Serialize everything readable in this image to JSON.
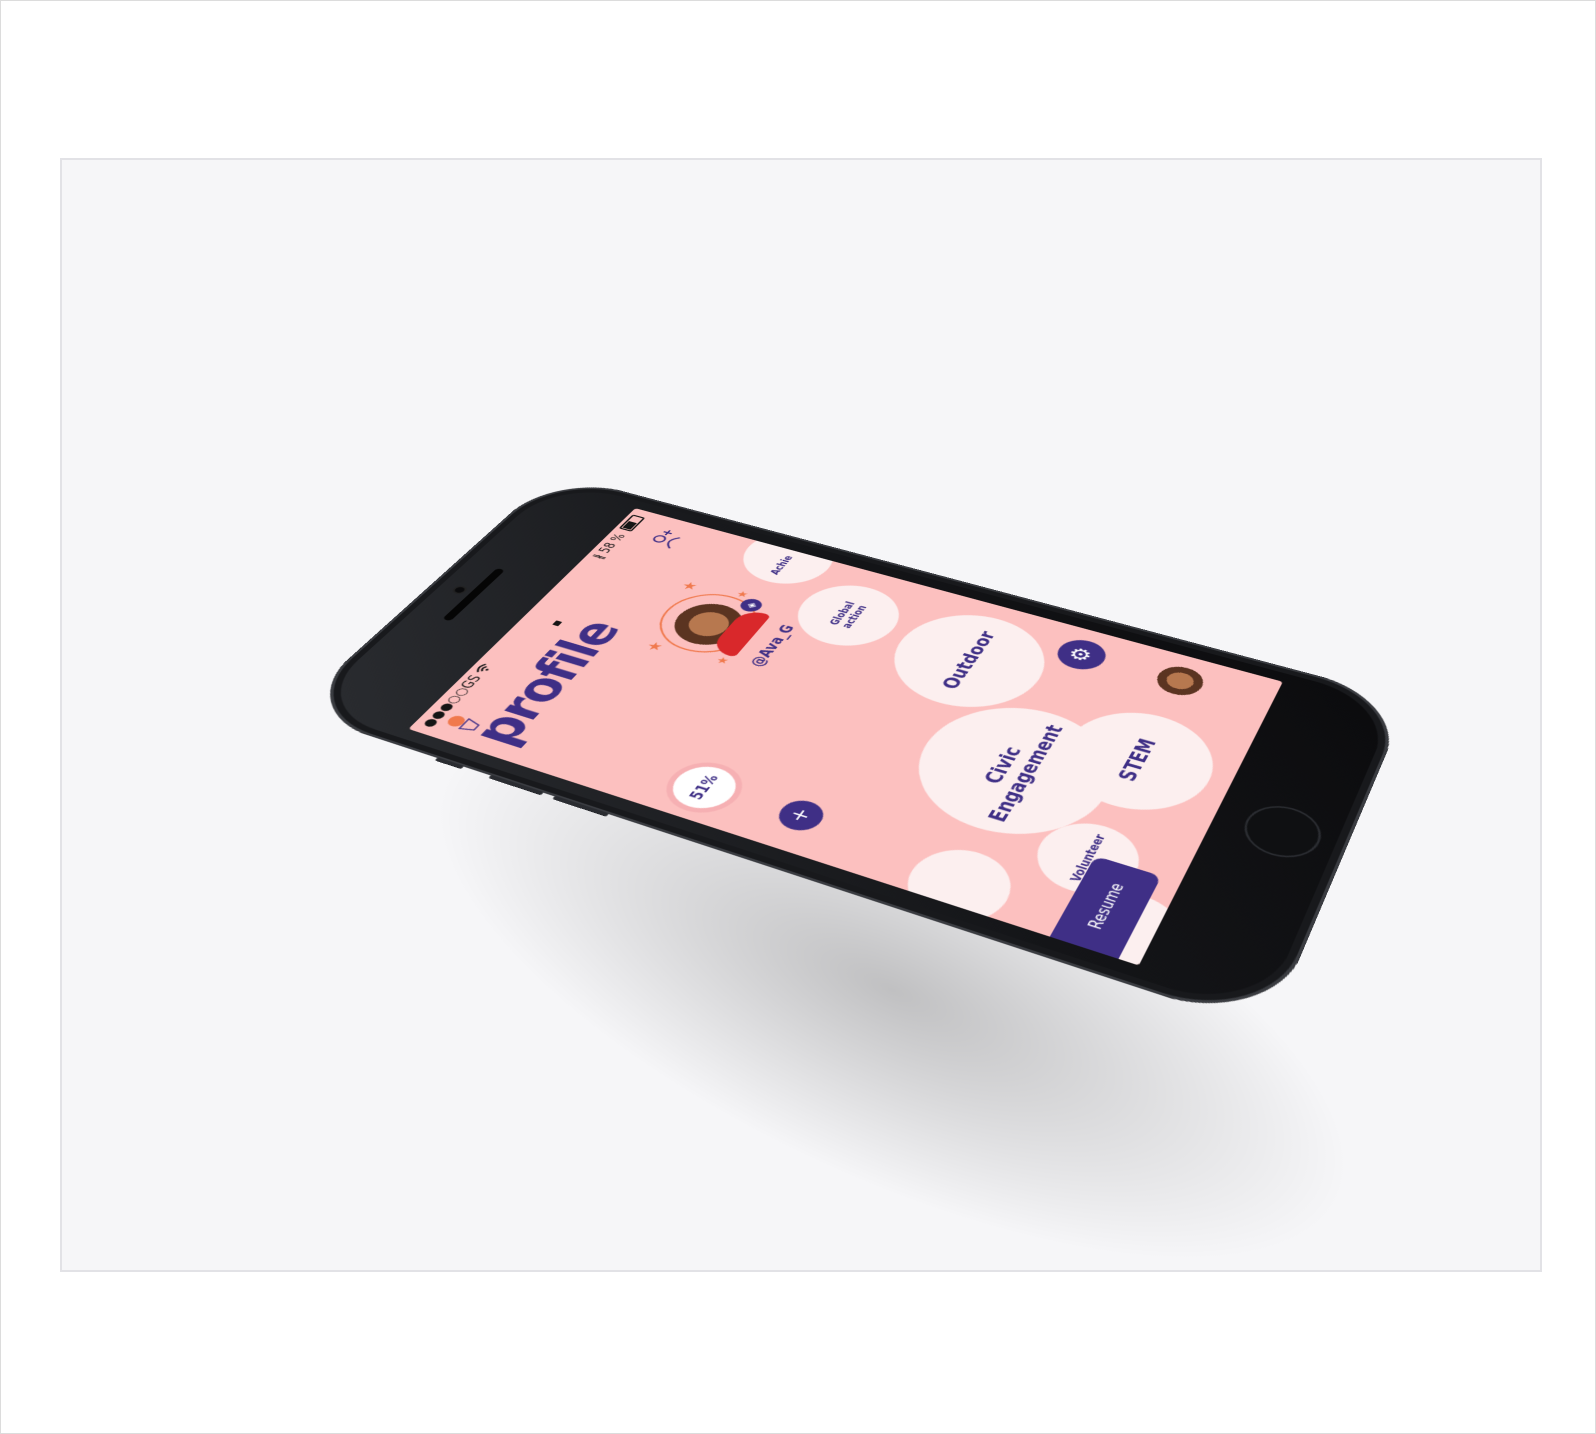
{
  "status": {
    "carrier": "●●●○○GS",
    "wifi_icon": "wifi-icon",
    "bluetooth": "∦",
    "battery_pct": "58 %"
  },
  "header": {
    "title": "profile",
    "add_friend_icon": "add-person-icon"
  },
  "profile": {
    "username": "@Ava_G",
    "progress": "51%",
    "badge_icon": "shield-icon"
  },
  "bubbles": {
    "global_action": "Global action",
    "achievements": "Achie",
    "outdoor": "Outdoor",
    "civic_engagement": "Civic Engagement",
    "volunteer": "Volunteer",
    "stem": "STEM"
  },
  "actions": {
    "add": "+",
    "settings_icon": "gear-icon",
    "resume": "Resume"
  },
  "colors": {
    "screen_bg": "#fcc0bf",
    "accent": "#3f2f86",
    "bubble": "#fcefef",
    "orange": "#f0794d"
  }
}
